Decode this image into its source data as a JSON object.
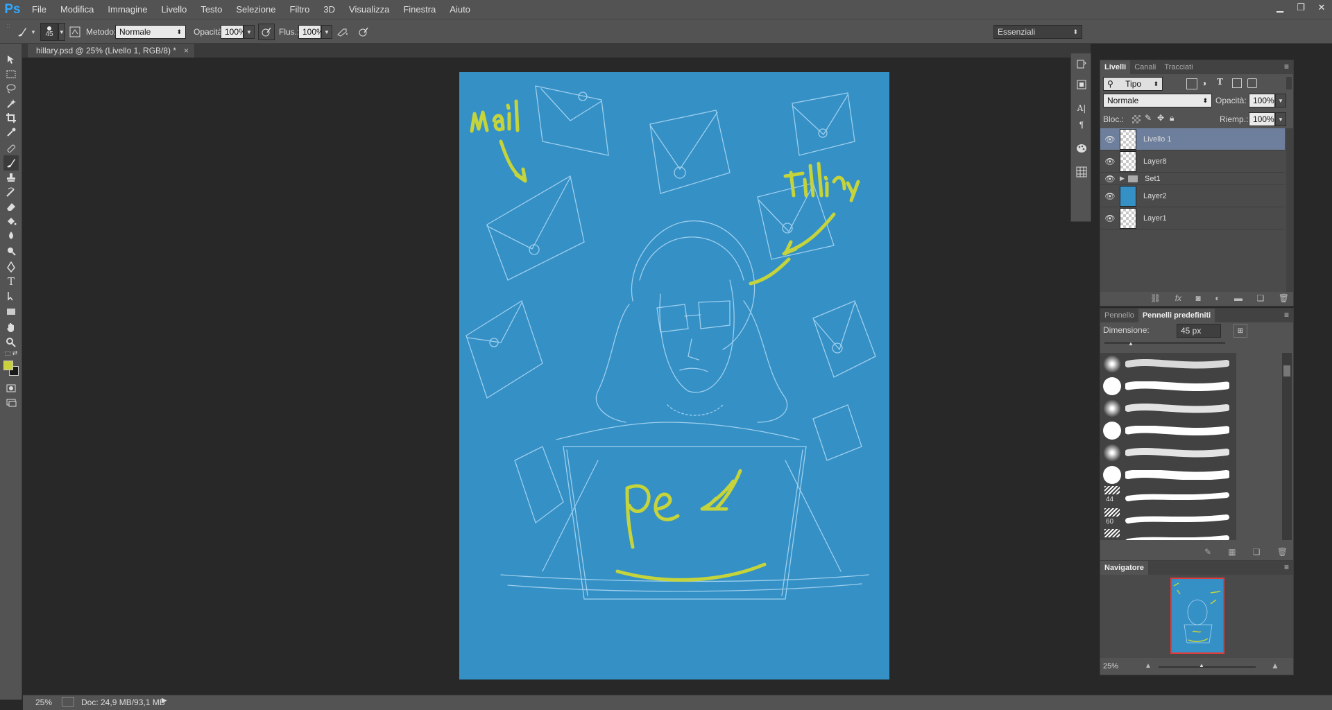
{
  "app": {
    "logo": "Ps"
  },
  "menu": [
    "File",
    "Modifica",
    "Immagine",
    "Livello",
    "Testo",
    "Selezione",
    "Filtro",
    "3D",
    "Visualizza",
    "Finestra",
    "Aiuto"
  ],
  "window_controls": [
    "minimize",
    "restore",
    "close"
  ],
  "options": {
    "brush_size": "45",
    "mode_label": "Metodo:",
    "mode_value": "Normale",
    "opacity_label": "Opacità:",
    "opacity_value": "100%",
    "flow_label": "Flus.:",
    "flow_value": "100%",
    "workspace": "Essenziali"
  },
  "document": {
    "tab_title": "hillary.psd @ 25% (Livello 1, RGB/8) *",
    "tab_close": "×"
  },
  "artwork_text": {
    "mail": "mail",
    "hillary": "Hillary",
    "pec": "pec"
  },
  "colors": {
    "foreground": "#c9d23a",
    "background": "#1a1a1a",
    "canvas": "#3590c6",
    "accent_yellow": "#c4d43a"
  },
  "layers_panel": {
    "tabs": [
      "Livelli",
      "Canali",
      "Tracciati"
    ],
    "filter_kind": "Tipo",
    "blend_mode": "Normale",
    "opacity_label": "Opacità:",
    "opacity_value": "100%",
    "lock_label": "Bloc.:",
    "fill_label": "Riemp.:",
    "fill_value": "100%",
    "layers": [
      {
        "name": "Livello 1",
        "selected": true,
        "thumb": "transparent"
      },
      {
        "name": "Layer8",
        "selected": false,
        "thumb": "transparent"
      },
      {
        "name": "Set1",
        "selected": false,
        "thumb": "folder"
      },
      {
        "name": "Layer2",
        "selected": false,
        "thumb": "blue"
      },
      {
        "name": "Layer1",
        "selected": false,
        "thumb": "transparent"
      }
    ]
  },
  "brush_panel": {
    "tabs": [
      "Pennello",
      "Pennelli predefiniti"
    ],
    "size_label": "Dimensione:",
    "size_value": "45 px",
    "presets": [
      {
        "tip": "soft",
        "label": ""
      },
      {
        "tip": "hard",
        "label": ""
      },
      {
        "tip": "soft",
        "label": ""
      },
      {
        "tip": "hard",
        "label": ""
      },
      {
        "tip": "soft",
        "label": ""
      },
      {
        "tip": "hard",
        "label": ""
      },
      {
        "tip": "texture",
        "label": "44"
      },
      {
        "tip": "texture",
        "label": "60"
      },
      {
        "tip": "texture",
        "label": ""
      }
    ]
  },
  "navigator": {
    "title": "Navigatore",
    "zoom": "25%"
  },
  "status": {
    "zoom": "25%",
    "doc": "Doc: 24,9 MB/93,1 MB"
  }
}
